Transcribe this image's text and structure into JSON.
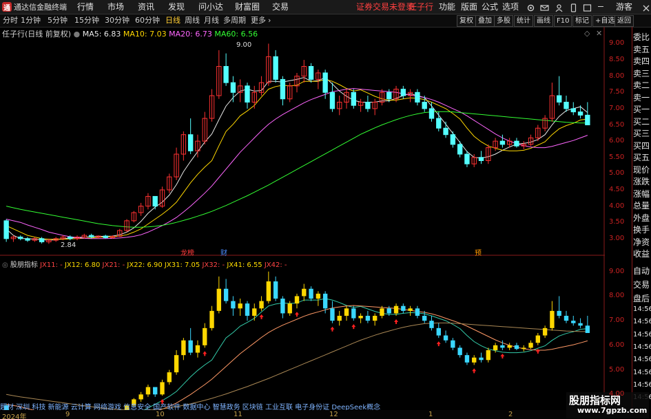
{
  "app": {
    "title": "通达信金融终端",
    "logo_icon": "tdx-logo-icon"
  },
  "menu": {
    "items": [
      "行情",
      "市场",
      "资讯",
      "发现",
      "问小达",
      "财富圈",
      "交易"
    ],
    "notice": "证券交易未登录",
    "stock": "任子行",
    "right_items": [
      "功能",
      "版面",
      "公式",
      "选项"
    ],
    "guest": "游客",
    "window_controls": [
      "minimize-icon",
      "maximize-icon",
      "close-icon"
    ]
  },
  "periods": {
    "items": [
      "分时",
      "1分钟",
      "5分钟",
      "15分钟",
      "30分钟",
      "60分钟",
      "日线",
      "周线",
      "月线",
      "多周期",
      "更多"
    ],
    "active": "日线",
    "more_arrow": "chevron-right-icon"
  },
  "tools": {
    "items": [
      "复权",
      "叠加",
      "多股",
      "统计",
      "画线",
      "F10",
      "标记",
      "+自选",
      "返回"
    ]
  },
  "main_chart": {
    "title": "任子行(日线 前复权)",
    "ma": [
      {
        "label": "MA5: 6.83",
        "color": "#e8e8e8"
      },
      {
        "label": "MA10: 7.03",
        "color": "#ffd700"
      },
      {
        "label": "MA20: 6.73",
        "color": "#ff66ff"
      },
      {
        "label": "MA60: 6.56",
        "color": "#33ff33"
      }
    ],
    "y_ticks": [
      "9.00",
      "8.50",
      "8.00",
      "7.50",
      "7.00",
      "6.50",
      "6.00",
      "5.50",
      "5.00",
      "4.50",
      "4.00",
      "3.50",
      "3.00"
    ],
    "high_label": "9.00",
    "low_label": "2.84",
    "markers": [
      {
        "text": "龙榜",
        "color": "#ff3b3b"
      },
      {
        "text": "财",
        "color": "#4a8cff"
      },
      {
        "text": "预",
        "color": "#ff9900"
      }
    ]
  },
  "sub_chart": {
    "title": "股朋指标",
    "lines": [
      {
        "label": "JX11: -",
        "color": "#ff3333"
      },
      {
        "label": "JX12: 6.80",
        "color": "#ffdd00"
      },
      {
        "label": "JX21: -",
        "color": "#ff3333"
      },
      {
        "label": "JX22: 6.90",
        "color": "#ffdd00"
      },
      {
        "label": "JX31: 7.05",
        "color": "#ffdd00"
      },
      {
        "label": "JX32: -",
        "color": "#ff3333"
      },
      {
        "label": "JX41: 6.55",
        "color": "#ffdd00"
      },
      {
        "label": "JX42: -",
        "color": "#ff3333"
      }
    ],
    "y_ticks": [
      "9.00",
      "8.00",
      "7.00",
      "6.00",
      "5.00",
      "4.00"
    ]
  },
  "right_panel": {
    "top": [
      "委比",
      "卖五",
      "卖四",
      "卖三",
      "卖二",
      "卖一",
      "买一",
      "买二",
      "买三",
      "买四",
      "买五",
      "现价",
      "涨跌",
      "涨幅",
      "总量",
      "外盘",
      "换手",
      "净资",
      "收益"
    ],
    "bottom": [
      "自动",
      "交易",
      "盘后"
    ],
    "times": [
      "14:56",
      "14:56",
      "14:56",
      "14:56",
      "14:56",
      "14:56",
      "14:56",
      "14:56"
    ]
  },
  "ticker": {
    "text": "题材 深圳 科技 新能源 云计算 网络游戏 信息安全 国产软件 数据中心 智慧政务 区块链 工业互联 电子身份证 DeepSeek概念"
  },
  "dates": [
    "2024年",
    "9",
    "10",
    "11",
    "12",
    "1",
    "2"
  ],
  "watermark": {
    "line1": "股朋指标网",
    "line2": "www.7gpzb.com"
  },
  "chart_data": [
    {
      "type": "candlestick",
      "title": "任子行(日线 前复权)",
      "ylim": [
        2.7,
        9.2
      ],
      "ohlc": [
        [
          3.55,
          3.6,
          2.9,
          3.0
        ],
        [
          3.0,
          3.1,
          2.9,
          3.05
        ],
        [
          3.05,
          3.1,
          2.95,
          3.0
        ],
        [
          3.0,
          3.05,
          2.9,
          2.95
        ],
        [
          2.95,
          3.05,
          2.9,
          3.0
        ],
        [
          3.0,
          3.05,
          2.85,
          2.9
        ],
        [
          2.9,
          3.0,
          2.84,
          2.95
        ],
        [
          2.95,
          3.05,
          2.9,
          3.0
        ],
        [
          3.0,
          3.1,
          2.95,
          3.05
        ],
        [
          3.05,
          3.1,
          2.95,
          3.0
        ],
        [
          3.0,
          3.1,
          2.95,
          3.05
        ],
        [
          3.05,
          3.15,
          3.0,
          3.1
        ],
        [
          3.1,
          3.15,
          3.0,
          3.05
        ],
        [
          3.05,
          3.1,
          3.0,
          3.08
        ],
        [
          3.08,
          3.12,
          3.0,
          3.03
        ],
        [
          3.03,
          3.1,
          3.0,
          3.07
        ],
        [
          3.07,
          3.3,
          3.05,
          3.25
        ],
        [
          3.25,
          3.6,
          3.2,
          3.55
        ],
        [
          3.55,
          3.85,
          3.5,
          3.8
        ],
        [
          3.8,
          4.1,
          3.7,
          4.0
        ],
        [
          4.0,
          4.4,
          3.9,
          4.3
        ],
        [
          4.3,
          4.2,
          3.9,
          4.0
        ],
        [
          4.0,
          4.6,
          3.95,
          4.5
        ],
        [
          4.5,
          5.0,
          4.4,
          4.9
        ],
        [
          4.9,
          5.8,
          4.8,
          5.6
        ],
        [
          5.6,
          6.3,
          5.4,
          6.2
        ],
        [
          6.2,
          6.7,
          5.6,
          5.7
        ],
        [
          5.7,
          6.2,
          5.5,
          6.0
        ],
        [
          6.0,
          6.9,
          5.9,
          6.7
        ],
        [
          6.7,
          7.6,
          6.6,
          7.4
        ],
        [
          7.4,
          8.8,
          7.3,
          8.3
        ],
        [
          8.3,
          8.7,
          7.7,
          7.8
        ],
        [
          7.8,
          8.0,
          7.2,
          7.5
        ],
        [
          7.5,
          7.9,
          7.2,
          7.7
        ],
        [
          7.7,
          7.8,
          7.0,
          7.2
        ],
        [
          7.2,
          7.7,
          7.0,
          7.5
        ],
        [
          7.5,
          8.0,
          7.4,
          7.8
        ],
        [
          7.8,
          9.0,
          7.7,
          8.6
        ],
        [
          8.6,
          8.8,
          7.8,
          7.9
        ],
        [
          7.9,
          8.0,
          7.1,
          7.3
        ],
        [
          7.3,
          7.8,
          7.2,
          7.7
        ],
        [
          7.7,
          8.1,
          7.5,
          8.0
        ],
        [
          8.0,
          8.5,
          7.8,
          8.3
        ],
        [
          8.3,
          8.4,
          7.8,
          7.9
        ],
        [
          7.9,
          8.2,
          7.6,
          8.1
        ],
        [
          8.1,
          8.2,
          7.3,
          7.5
        ],
        [
          7.5,
          7.8,
          6.9,
          7.0
        ],
        [
          7.0,
          7.4,
          6.8,
          7.2
        ],
        [
          7.2,
          7.6,
          7.0,
          7.5
        ],
        [
          7.5,
          7.6,
          7.0,
          7.1
        ],
        [
          7.1,
          7.3,
          6.9,
          7.2
        ],
        [
          7.2,
          7.4,
          6.9,
          7.0
        ],
        [
          7.0,
          7.3,
          6.8,
          7.2
        ],
        [
          7.2,
          7.6,
          7.1,
          7.5
        ],
        [
          7.5,
          7.6,
          7.2,
          7.3
        ],
        [
          7.3,
          7.7,
          7.2,
          7.6
        ],
        [
          7.6,
          7.7,
          7.3,
          7.4
        ],
        [
          7.4,
          7.6,
          7.2,
          7.5
        ],
        [
          7.5,
          7.6,
          7.1,
          7.2
        ],
        [
          7.2,
          7.4,
          6.9,
          7.0
        ],
        [
          7.0,
          7.2,
          6.6,
          6.7
        ],
        [
          6.7,
          6.9,
          6.3,
          6.4
        ],
        [
          6.4,
          6.6,
          6.1,
          6.2
        ],
        [
          6.2,
          6.3,
          5.8,
          5.9
        ],
        [
          5.9,
          6.0,
          5.5,
          5.6
        ],
        [
          5.6,
          5.7,
          5.2,
          5.3
        ],
        [
          5.3,
          5.6,
          5.2,
          5.5
        ],
        [
          5.5,
          5.7,
          5.3,
          5.4
        ],
        [
          5.4,
          5.9,
          5.3,
          5.8
        ],
        [
          5.8,
          6.1,
          5.7,
          6.0
        ],
        [
          6.0,
          6.2,
          5.8,
          5.9
        ],
        [
          5.9,
          6.1,
          5.8,
          6.0
        ],
        [
          6.0,
          6.1,
          5.8,
          5.85
        ],
        [
          5.85,
          6.0,
          5.75,
          5.9
        ],
        [
          5.9,
          6.2,
          5.85,
          6.1
        ],
        [
          6.1,
          6.5,
          6.0,
          6.4
        ],
        [
          6.4,
          6.8,
          6.3,
          6.7
        ],
        [
          6.7,
          7.8,
          6.6,
          7.4
        ],
        [
          7.4,
          8.0,
          7.1,
          7.2
        ],
        [
          7.2,
          7.4,
          6.9,
          7.0
        ],
        [
          7.0,
          7.2,
          6.8,
          6.9
        ],
        [
          6.9,
          7.1,
          6.7,
          6.8
        ],
        [
          6.8,
          7.2,
          6.6,
          6.5
        ]
      ],
      "series": [
        {
          "name": "MA5",
          "values": [
            3.3,
            3.1,
            3.0,
            3.0,
            2.98,
            2.97,
            2.95,
            2.97,
            3.0,
            3.02,
            3.03,
            3.05,
            3.06,
            3.07,
            3.07,
            3.08,
            3.12,
            3.2,
            3.33,
            3.53,
            3.78,
            3.97,
            4.12,
            4.34,
            4.66,
            5.06,
            5.38,
            5.68,
            5.97,
            6.22,
            6.66,
            7.08,
            7.34,
            7.54,
            7.6,
            7.54,
            7.56,
            7.84,
            7.84,
            7.82,
            7.86,
            7.9,
            7.96,
            7.84,
            7.86,
            7.96,
            7.76,
            7.54,
            7.38,
            7.26,
            7.2,
            7.2,
            7.2,
            7.24,
            7.24,
            7.32,
            7.4,
            7.46,
            7.4,
            7.34,
            7.08,
            6.8,
            6.52,
            6.24,
            5.96,
            5.68,
            5.5,
            5.48,
            5.52,
            5.6,
            5.72,
            5.82,
            5.91,
            5.93,
            5.97,
            6.05,
            6.2,
            6.5,
            6.76,
            6.94,
            7.0,
            7.06,
            6.88
          ],
          "color": "#e8e8e8"
        },
        {
          "name": "MA10",
          "values": [
            3.4,
            3.3,
            3.2,
            3.1,
            3.05,
            3.0,
            2.98,
            2.98,
            2.98,
            2.99,
            3.0,
            3.01,
            3.02,
            3.04,
            3.05,
            3.06,
            3.08,
            3.12,
            3.2,
            3.3,
            3.45,
            3.6,
            3.75,
            3.92,
            4.12,
            4.42,
            4.72,
            4.98,
            5.2,
            5.4,
            5.86,
            6.3,
            6.52,
            6.78,
            6.93,
            7.1,
            7.36,
            7.6,
            7.68,
            7.72,
            7.7,
            7.72,
            7.84,
            7.84,
            7.84,
            7.9,
            7.84,
            7.74,
            7.62,
            7.54,
            7.58,
            7.48,
            7.38,
            7.3,
            7.26,
            7.26,
            7.3,
            7.33,
            7.32,
            7.28,
            7.2,
            7.1,
            7.0,
            6.85,
            6.68,
            6.4,
            6.15,
            5.98,
            5.85,
            5.78,
            5.72,
            5.7,
            5.7,
            5.72,
            5.78,
            5.88,
            5.98,
            6.2,
            6.38,
            6.48,
            6.55,
            6.65,
            6.68
          ],
          "color": "#ffd700"
        },
        {
          "name": "MA20",
          "values": [
            3.6,
            3.55,
            3.5,
            3.42,
            3.35,
            3.28,
            3.2,
            3.15,
            3.1,
            3.06,
            3.03,
            3.01,
            3.0,
            3.0,
            3.0,
            3.01,
            3.02,
            3.04,
            3.07,
            3.12,
            3.2,
            3.3,
            3.4,
            3.52,
            3.65,
            3.82,
            4.0,
            4.2,
            4.4,
            4.62,
            4.88,
            5.14,
            5.4,
            5.66,
            5.88,
            6.1,
            6.32,
            6.52,
            6.68,
            6.82,
            6.94,
            7.06,
            7.18,
            7.28,
            7.36,
            7.44,
            7.52,
            7.56,
            7.6,
            7.62,
            7.6,
            7.58,
            7.56,
            7.54,
            7.52,
            7.5,
            7.46,
            7.42,
            7.38,
            7.34,
            7.28,
            7.2,
            7.1,
            7.0,
            6.9,
            6.78,
            6.64,
            6.5,
            6.36,
            6.22,
            6.1,
            6.0,
            5.92,
            5.86,
            5.82,
            5.8,
            5.8,
            5.84,
            5.9,
            5.96,
            6.02,
            6.1,
            6.18
          ],
          "color": "#ff66ff"
        },
        {
          "name": "MA60",
          "values": [
            4.0,
            3.95,
            3.9,
            3.86,
            3.82,
            3.78,
            3.74,
            3.7,
            3.66,
            3.62,
            3.58,
            3.54,
            3.5,
            3.46,
            3.43,
            3.4,
            3.38,
            3.36,
            3.35,
            3.35,
            3.36,
            3.38,
            3.41,
            3.45,
            3.5,
            3.56,
            3.62,
            3.69,
            3.76,
            3.84,
            3.93,
            4.02,
            4.12,
            4.22,
            4.32,
            4.43,
            4.54,
            4.65,
            4.77,
            4.89,
            5.01,
            5.13,
            5.25,
            5.37,
            5.49,
            5.61,
            5.73,
            5.85,
            5.97,
            6.09,
            6.21,
            6.31,
            6.41,
            6.5,
            6.58,
            6.66,
            6.73,
            6.79,
            6.84,
            6.88,
            6.9,
            6.91,
            6.91,
            6.9,
            6.88,
            6.86,
            6.84,
            6.82,
            6.8,
            6.78,
            6.76,
            6.74,
            6.72,
            6.7,
            6.68,
            6.66,
            6.64,
            6.62,
            6.6,
            6.58,
            6.57,
            6.56,
            6.56
          ],
          "color": "#33ff33"
        }
      ]
    },
    {
      "type": "candlestick",
      "title": "股朋指标",
      "ylim": [
        3.7,
        9.3
      ]
    }
  ]
}
